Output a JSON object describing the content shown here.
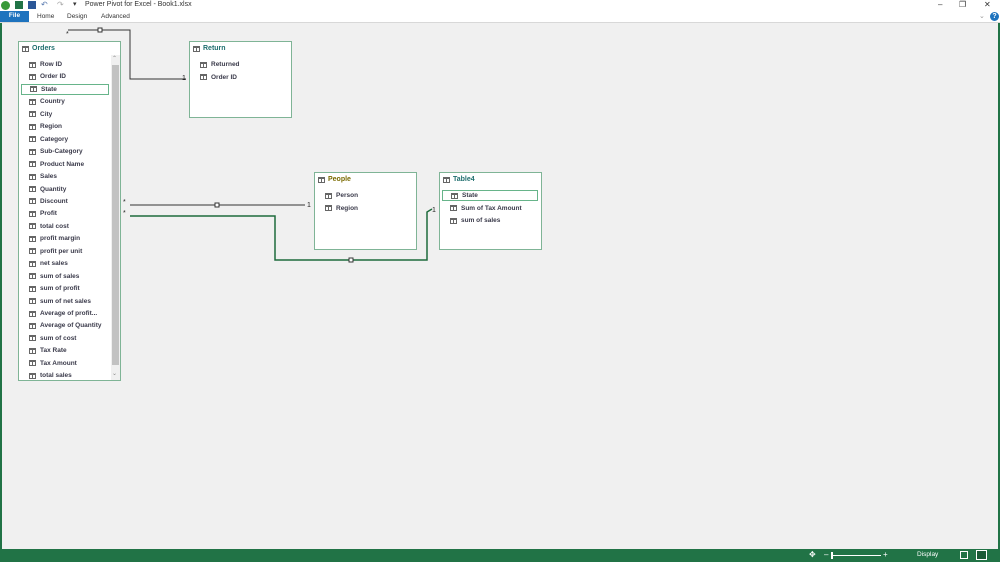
{
  "window": {
    "title": "Power Pivot for Excel - Book1.xlsx",
    "minimize": "–",
    "restore": "❐",
    "close": "✕",
    "help": "?"
  },
  "ribbon": {
    "tabs": [
      "File",
      "Home",
      "Design",
      "Advanced"
    ]
  },
  "tables": {
    "orders": {
      "title": "Orders",
      "fields": [
        "Row ID",
        "Order ID",
        "State",
        "Country",
        "City",
        "Region",
        "Category",
        "Sub-Category",
        "Product Name",
        "Sales",
        "Quantity",
        "Discount",
        "Profit",
        "total cost",
        "profit margin",
        "profit per unit",
        "net sales",
        "sum of sales",
        "sum of profit",
        "sum of net sales",
        "Average of profit...",
        "Average of Quantity",
        "sum of cost",
        "Tax Rate",
        "Tax Amount",
        "total sales"
      ],
      "selected": "State"
    },
    "return": {
      "title": "Return",
      "fields": [
        "Returned",
        "Order ID"
      ]
    },
    "people": {
      "title": "People",
      "fields": [
        "Person",
        "Region"
      ]
    },
    "table4": {
      "title": "Table4",
      "fields": [
        "State",
        "Sum of Tax Amount",
        "sum of sales"
      ],
      "selected": "State"
    }
  },
  "relationships": {
    "many": "*",
    "one": "1"
  },
  "status": {
    "display": "Display"
  },
  "colors": {
    "accent": "#217346",
    "file_tab": "#1e73be",
    "title_teal": "#1f6e6e",
    "title_olive": "#7a6a00"
  }
}
